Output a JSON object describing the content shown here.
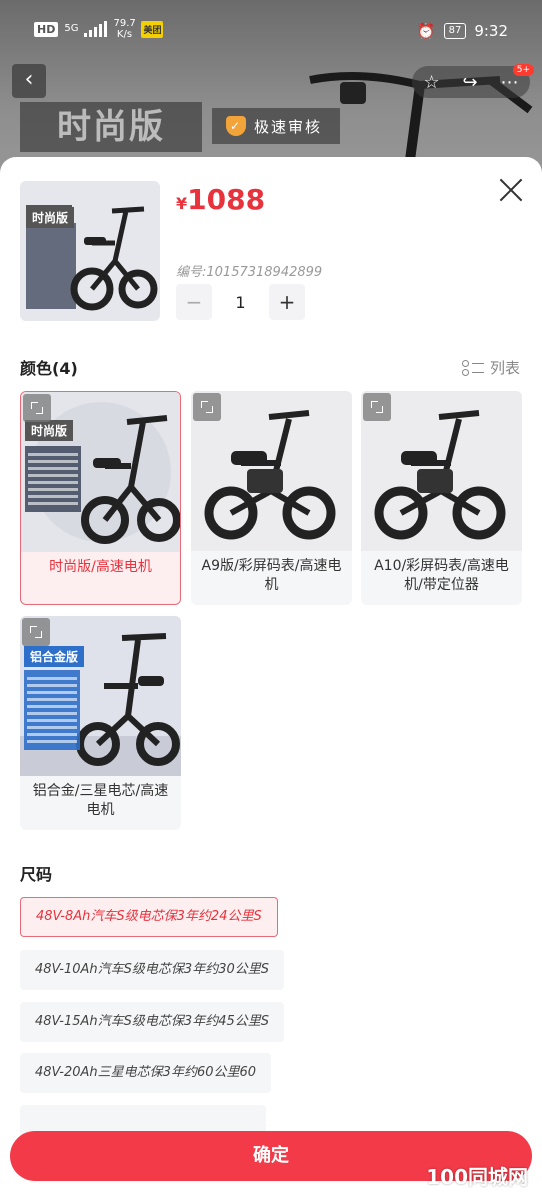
{
  "status_bar": {
    "hd": "HD",
    "network": "5G",
    "speed_value": "79.7",
    "speed_unit": "K/s",
    "app_badge": "美团",
    "battery": "87",
    "time": "9:32"
  },
  "header": {
    "style_banner": "时尚版",
    "review_tag": "极速审核",
    "cart_badge": "5+"
  },
  "product": {
    "currency": "¥",
    "price": "1088",
    "sku_label": "编号:",
    "sku": "10157318942899",
    "quantity": "1",
    "qty_minus": "−",
    "qty_plus": "+"
  },
  "color_section": {
    "title": "颜色(4)",
    "list_toggle": "列表",
    "options": [
      {
        "label": "时尚版/高速电机",
        "selected": true,
        "tag": "时尚版"
      },
      {
        "label": "A9版/彩屏码表/高速电机",
        "selected": false,
        "tag": ""
      },
      {
        "label": "A10/彩屏码表/高速电机/带定位器",
        "selected": false,
        "tag": ""
      },
      {
        "label": "铝合金/三星电芯/高速电机",
        "selected": false,
        "tag": "铝合金版"
      }
    ]
  },
  "size_section": {
    "title": "尺码",
    "options": [
      {
        "label": "48V-8Ah汽车S级电芯保3年约24公里S",
        "selected": true
      },
      {
        "label": "48V-10Ah汽车S级电芯保3年约30公里S",
        "selected": false
      },
      {
        "label": "48V-15Ah汽车S级电芯保3年约45公里S",
        "selected": false
      },
      {
        "label": "48V-20Ah三星电芯保3年约60公里60",
        "selected": false
      }
    ]
  },
  "footer": {
    "confirm": "确定",
    "watermark": "100同城网"
  },
  "colors": {
    "accent": "#e8323c",
    "confirm_bg": "#f23a48",
    "selected_bg": "#fdeef0"
  }
}
